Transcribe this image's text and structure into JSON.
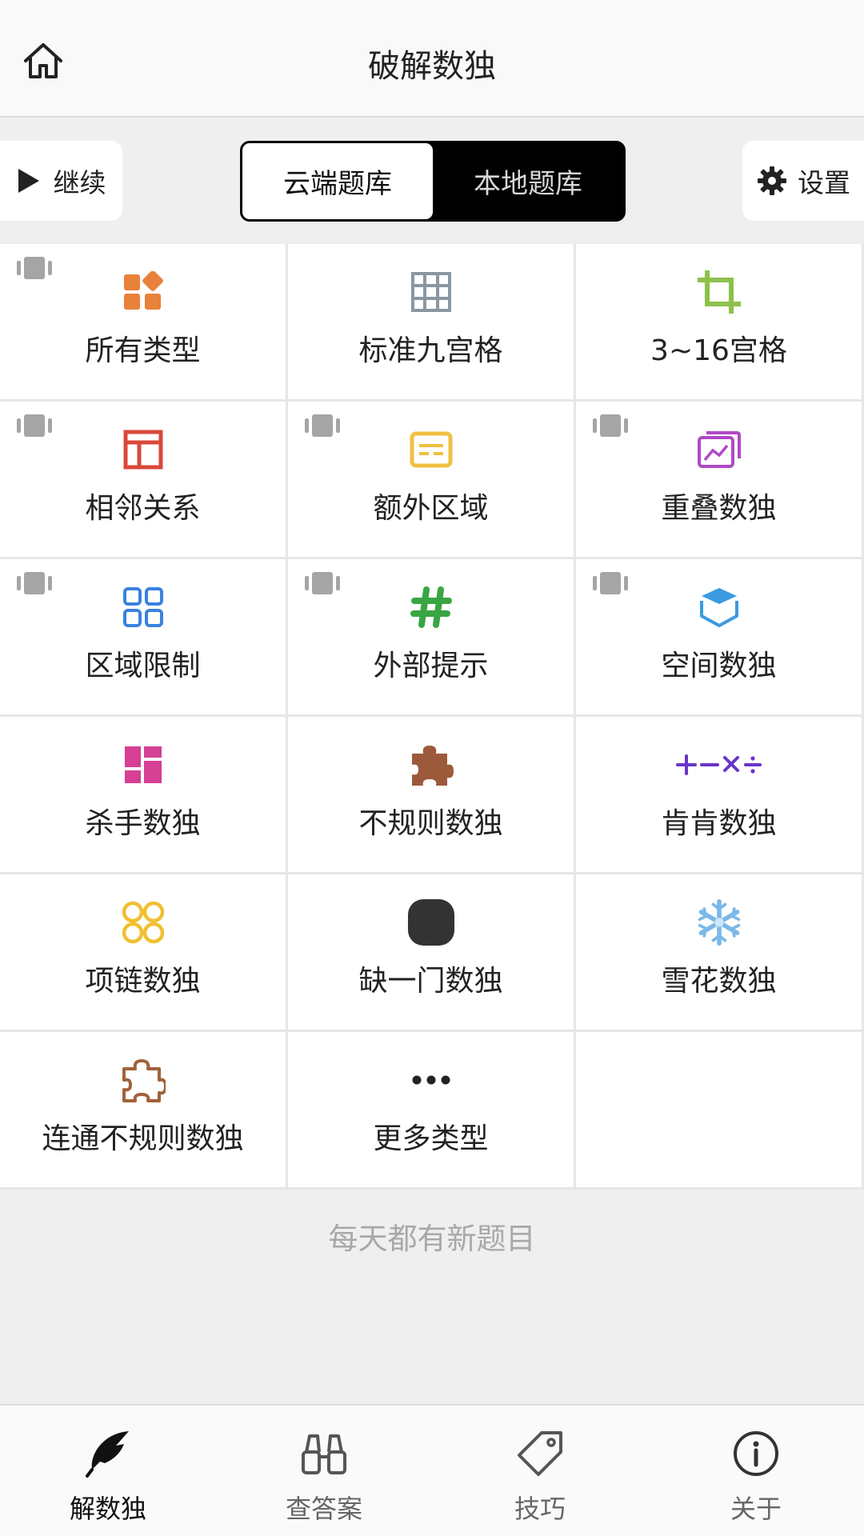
{
  "header": {
    "title": "破解数独",
    "home_icon": "home-icon"
  },
  "toolbar": {
    "continue_label": "继续",
    "segments": [
      {
        "label": "云端题库",
        "active": true
      },
      {
        "label": "本地题库",
        "active": false
      }
    ],
    "settings_label": "设置"
  },
  "grid": [
    {
      "label": "所有类型",
      "icon": "blocks-icon",
      "color": "#e8823a",
      "badge": true
    },
    {
      "label": "标准九宫格",
      "icon": "grid-icon",
      "color": "#8a97a3",
      "badge": false
    },
    {
      "label": "3~16宫格",
      "icon": "crop-icon",
      "color": "#8cc04a",
      "badge": false
    },
    {
      "label": "相邻关系",
      "icon": "layout-icon",
      "color": "#d9483a",
      "badge": true
    },
    {
      "label": "额外区域",
      "icon": "card-icon",
      "color": "#f0c040",
      "badge": true
    },
    {
      "label": "重叠数独",
      "icon": "gallery-icon",
      "color": "#b049c4",
      "badge": true
    },
    {
      "label": "区域限制",
      "icon": "squares-icon",
      "color": "#3a82e0",
      "badge": true
    },
    {
      "label": "外部提示",
      "icon": "hashtag-icon",
      "color": "#3aa543",
      "badge": true
    },
    {
      "label": "空间数独",
      "icon": "cube-icon",
      "color": "#3a9be0",
      "badge": true
    },
    {
      "label": "杀手数独",
      "icon": "dashboard-icon",
      "color": "#d63f93",
      "badge": false
    },
    {
      "label": "不规则数独",
      "icon": "puzzle-icon",
      "color": "#9c5a3a",
      "badge": false
    },
    {
      "label": "肯肯数独",
      "icon": "math-ops-icon",
      "color": "#6a35c8",
      "badge": false
    },
    {
      "label": "项链数独",
      "icon": "necklace-icon",
      "color": "#f0c030",
      "badge": false
    },
    {
      "label": "缺一门数独",
      "icon": "rounded-square-icon",
      "color": "#333333",
      "badge": false
    },
    {
      "label": "雪花数独",
      "icon": "snowflake-icon",
      "color": "#7ab8e8",
      "badge": false
    },
    {
      "label": "连通不规则数独",
      "icon": "puzzle-outline-icon",
      "color": "#a0623a",
      "badge": false
    },
    {
      "label": "更多类型",
      "icon": "more-icon",
      "color": "#222222",
      "badge": false
    }
  ],
  "footer_note": "每天都有新题目",
  "bottom_nav": [
    {
      "label": "解数独",
      "icon": "feather-icon",
      "active": true
    },
    {
      "label": "查答案",
      "icon": "binoculars-icon",
      "active": false
    },
    {
      "label": "技巧",
      "icon": "tag-icon",
      "active": false
    },
    {
      "label": "关于",
      "icon": "info-icon",
      "active": false
    }
  ]
}
